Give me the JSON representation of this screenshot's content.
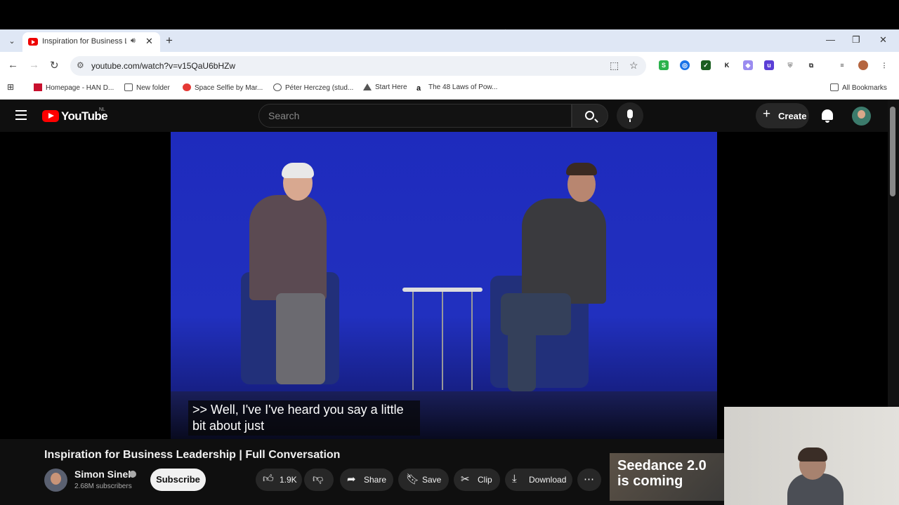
{
  "browser": {
    "tab_title": "Inspiration for Business Lea",
    "url": "youtube.com/watch?v=v15QaU6bHZw",
    "bookmarks": [
      "Homepage - HAN D...",
      "New folder",
      "Space Selfie by Mar...",
      "Péter Herczeg (stud...",
      "Start Here",
      "The 48 Laws of Pow..."
    ],
    "all_bookmarks": "All Bookmarks"
  },
  "youtube": {
    "logo_text": "YouTube",
    "country_code": "NL",
    "search_placeholder": "Search",
    "create_label": "Create"
  },
  "video": {
    "caption_line1": ">> Well, I've I've heard you say a little",
    "caption_line2": "bit about just",
    "title": "Inspiration for Business Leadership | Full Conversation",
    "channel_name": "Simon Sinek",
    "subscribers": "2.68M subscribers",
    "subscribe_label": "Subscribe",
    "likes": "1.9K",
    "share_label": "Share",
    "save_label": "Save",
    "clip_label": "Clip",
    "download_label": "Download"
  },
  "ad": {
    "line1": "Seedance 2.0",
    "line2": "is coming"
  },
  "colors": {
    "youtube_red": "#ff0000",
    "background": "#0f0f0f",
    "stage_blue": "#1e2bbd"
  }
}
